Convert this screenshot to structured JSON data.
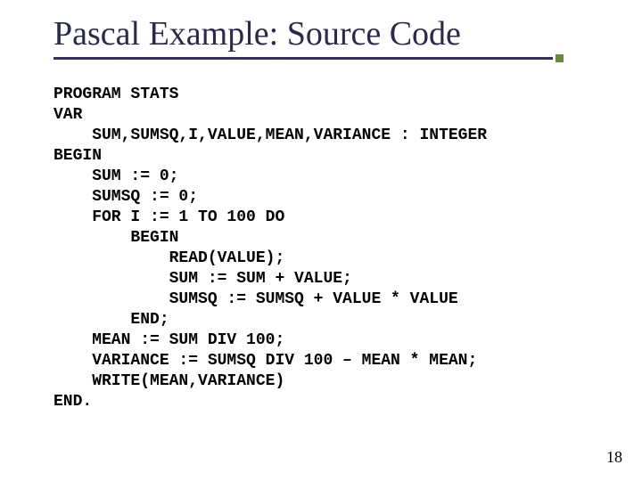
{
  "title": "Pascal Example: Source Code",
  "code": {
    "l01": "PROGRAM STATS",
    "l02": "VAR",
    "l03": "    SUM,SUMSQ,I,VALUE,MEAN,VARIANCE : INTEGER",
    "l04": "BEGIN",
    "l05": "    SUM := 0;",
    "l06": "    SUMSQ := 0;",
    "l07": "    FOR I := 1 TO 100 DO",
    "l08": "        BEGIN",
    "l09": "            READ(VALUE);",
    "l10": "            SUM := SUM + VALUE;",
    "l11": "            SUMSQ := SUMSQ + VALUE * VALUE",
    "l12": "        END;",
    "l13": "    MEAN := SUM DIV 100;",
    "l14": "    VARIANCE := SUMSQ DIV 100 – MEAN * MEAN;",
    "l15": "    WRITE(MEAN,VARIANCE)",
    "l16": "END."
  },
  "page_number": "18"
}
